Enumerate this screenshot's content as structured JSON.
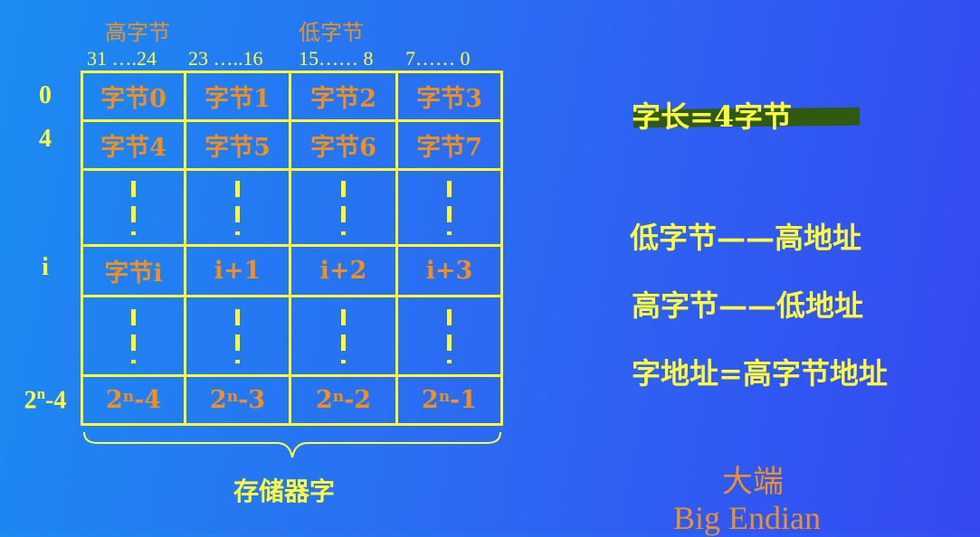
{
  "header": {
    "high_byte": "高字节",
    "low_byte": "低字节",
    "bit_ranges": [
      "31 ….24",
      "23 …..16",
      "15…… 8",
      "7…… 0"
    ]
  },
  "row_labels": {
    "r0": "0",
    "r1": "4",
    "ri": "i",
    "rn_base": "2",
    "rn_exp": "n",
    "rn_suffix": "-4"
  },
  "cells": {
    "row0": [
      "字节0",
      "字节1",
      "字节2",
      "字节3"
    ],
    "row1": [
      "字节4",
      "字节5",
      "字节6",
      "字节7"
    ],
    "rowi": [
      "字节i",
      "i+1",
      "i+2",
      "i+3"
    ],
    "rown": [
      {
        "base": "2",
        "exp": "n",
        "suffix": "-4"
      },
      {
        "base": "2",
        "exp": "n",
        "suffix": "-3"
      },
      {
        "base": "2",
        "exp": "n",
        "suffix": "-2"
      },
      {
        "base": "2",
        "exp": "n",
        "suffix": "-1"
      }
    ]
  },
  "brace_label": "存储器字",
  "notes": {
    "word_length": "字长=4字节",
    "line1": "低字节——高地址",
    "line2": "高字节——低地址",
    "line3": "字地址=高字节地址"
  },
  "endian": {
    "cn": "大端",
    "en": "Big Endian"
  },
  "colors": {
    "background": "#2a6ef2",
    "yellow": "#ffff40",
    "orange": "#f0901e",
    "highlight": "#2f5a10"
  }
}
